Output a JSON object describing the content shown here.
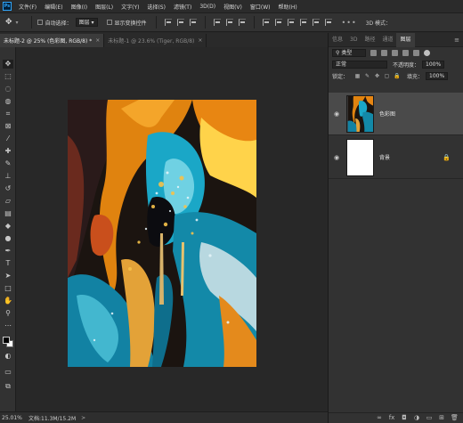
{
  "app": {
    "logo_text": "Ps"
  },
  "menu": [
    "文件(F)",
    "编辑(E)",
    "图像(I)",
    "图层(L)",
    "文字(Y)",
    "选择(S)",
    "滤镜(T)",
    "3D(D)",
    "视图(V)",
    "窗口(W)",
    "帮助(H)"
  ],
  "options": {
    "auto_select_label": "自动选择：",
    "auto_select_value": "图层",
    "show_transform_label": "显示变换控件",
    "mode_3d_label": "3D 模式："
  },
  "tabs": [
    {
      "label": "未标题-2 @ 25% (色彩图, RGB/8) *",
      "close": "×"
    },
    {
      "label": "未标题-1 @ 23.6% (Tiger, RGB/8)",
      "close": "×"
    }
  ],
  "panel": {
    "tabs": [
      "信息",
      "3D",
      "路径",
      "通道",
      "图层"
    ],
    "menu_icon": "≡",
    "filter_kind": "类型",
    "blend_mode": "正常",
    "opacity_label": "不透明度：",
    "opacity_value": "100%",
    "lock_label": "锁定：",
    "fill_label": "填充：",
    "fill_value": "100%",
    "layers": [
      {
        "name": "色彩图",
        "visible": true,
        "selected": true
      },
      {
        "name": "背景",
        "visible": true,
        "selected": false,
        "locked": true
      }
    ]
  },
  "status": {
    "zoom": "25.01%",
    "doc_info": "文档:11.3M/15.2M",
    "arrow": ">"
  },
  "colors": {
    "accent": "#31a8ff",
    "panel_bg": "#323232",
    "canvas_bg": "#282828"
  }
}
